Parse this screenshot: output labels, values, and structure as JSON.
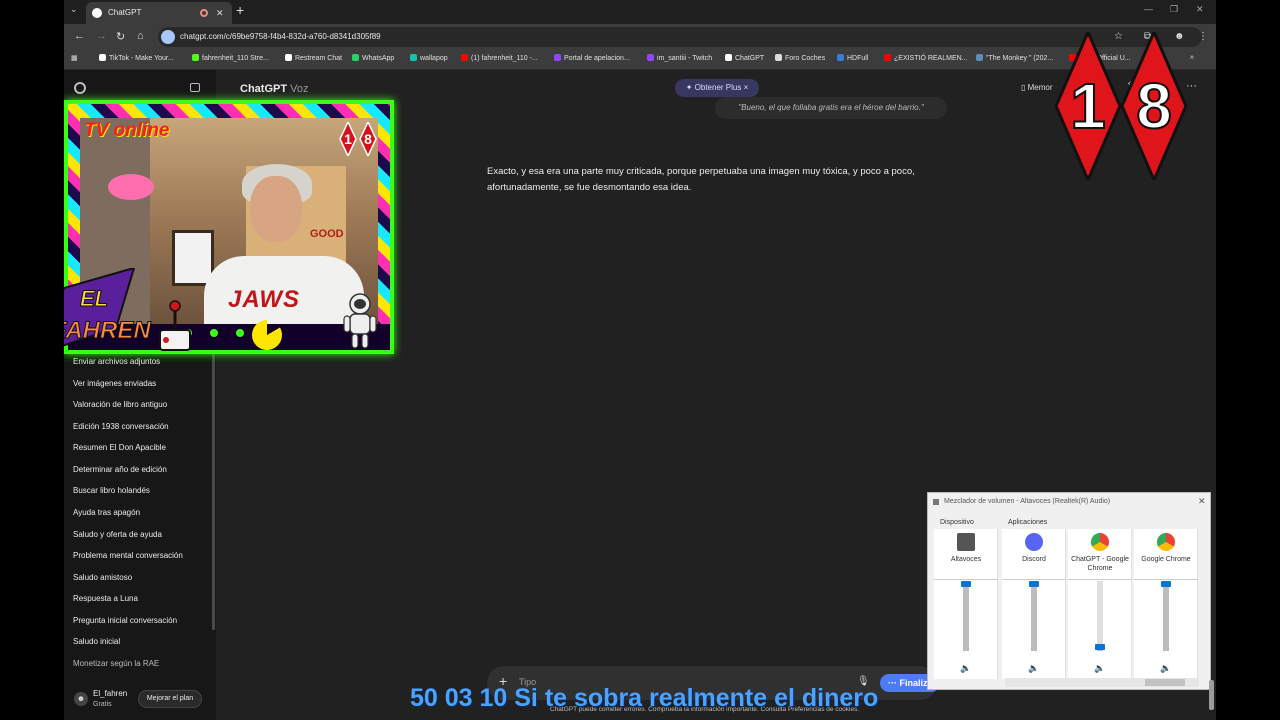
{
  "browser": {
    "tab_title": "ChatGPT",
    "url": "chatgpt.com/c/69be9758-f4b4-832d-a760-d8341d305f89",
    "bookmarks": [
      {
        "label": "TikTok - Make Your...",
        "color": "#ffffff"
      },
      {
        "label": "fahrenheit_110 Stre...",
        "color": "#53fc18"
      },
      {
        "label": "Restream Chat",
        "color": "#ffffff"
      },
      {
        "label": "WhatsApp",
        "color": "#25d366"
      },
      {
        "label": "wallapop",
        "color": "#13c1ac"
      },
      {
        "label": "(1) fahrenheit_110 -...",
        "color": "#ff0000"
      },
      {
        "label": "Portal de apelacion...",
        "color": "#9146ff"
      },
      {
        "label": "im_santiii - Twitch",
        "color": "#9146ff"
      },
      {
        "label": "ChatGPT",
        "color": "#ffffff"
      },
      {
        "label": "Foro Coches",
        "color": "#dddddd"
      },
      {
        "label": "HDFull",
        "color": "#3a7bd5"
      },
      {
        "label": "¿EXISTIÓ REALMEN...",
        "color": "#ff0000"
      },
      {
        "label": "\"The Monkey \" (202...",
        "color": "#5b8db8"
      },
      {
        "label": "...EN Official U...",
        "color": "#ff0000"
      }
    ]
  },
  "sidebar": {
    "items": [
      "Enviar archivos adjuntos",
      "Ver imágenes enviadas",
      "Valoración de libro antiguo",
      "Edición 1938 conversación",
      "Resumen El Don Apacible",
      "Determinar año de edición",
      "Buscar libro holandés",
      "Ayuda tras apagón",
      "Saludo y oferta de ayuda",
      "Problema mental conversación",
      "Saludo amistoso",
      "Respuesta a Luna",
      "Pregunta inicial conversación",
      "Saludo inicial",
      "Monetizar según la RAE"
    ],
    "user_name": "El_fahren",
    "user_plan": "Gratis",
    "upgrade_label": "Mejorar el plan"
  },
  "header": {
    "title": "ChatGPT",
    "mode": "Voz",
    "plus_label": "✦ Obtener Plus  ×",
    "quote": "\"Bueno, el que follaba gratis era el héroe del barrio.\"",
    "memory_label": "Memor"
  },
  "conversation": {
    "answer": "Exacto, y esa era una parte muy criticada, porque perpetuaba una imagen muy tóxica, y poco a poco, afortunadamente, se fue desmontando esa idea."
  },
  "composer": {
    "placeholder": "Tipo",
    "finalize_label": "··· Finaliz",
    "disclaimer": "ChatGPT puede cometer errores. Comprueba la información importante. Consulta Preferencias de cookies."
  },
  "overlay": {
    "tv_label": "TV online",
    "shirt_text": "JAWS",
    "poster_text": "GOOD",
    "logo_line1": "EL",
    "logo_line2": "FAHREN",
    "badge_digits": [
      "1",
      "8"
    ],
    "ticker": "50 03 10 Si te sobra realmente el dinero"
  },
  "volume_mixer": {
    "title": "Mezclador de volumen - Altavoces (Realtek(R) Audio)",
    "device_header": "Dispositivo",
    "apps_header": "Aplicaciones",
    "channels": [
      {
        "name": "Altavoces",
        "level": 1.0,
        "icon": "speaker-device-icon",
        "color": "#555555"
      },
      {
        "name": "Discord",
        "level": 1.0,
        "icon": "discord-icon",
        "color": "#5865f2"
      },
      {
        "name": "ChatGPT - Google Chrome",
        "level": 0.02,
        "icon": "chrome-icon",
        "color": "#4285f4"
      },
      {
        "name": "Google Chrome",
        "level": 1.0,
        "icon": "chrome-icon",
        "color": "#4285f4"
      }
    ]
  }
}
